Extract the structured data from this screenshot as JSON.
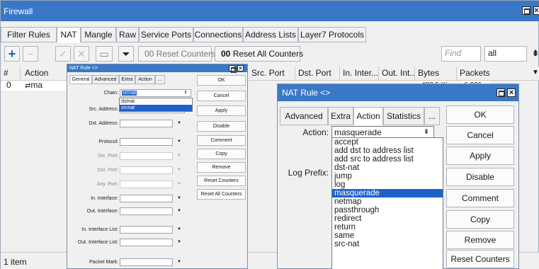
{
  "firewall": {
    "title": "Firewall",
    "tabs": [
      "Filter Rules",
      "NAT",
      "Mangle",
      "Raw",
      "Service Ports",
      "Connections",
      "Address Lists",
      "Layer7 Protocols"
    ],
    "toolbar": {
      "add_icon": "plus-icon",
      "remove_icon": "minus-icon",
      "enable_icon": "check-icon",
      "disable_icon": "cross-icon",
      "comment_icon": "note-icon",
      "filter_icon": "filter-icon",
      "reset_counters": "Reset Counters",
      "reset_all_counters": "Reset All Counters",
      "counter_prefix": "00",
      "find_placeholder": "Find",
      "scope_value": "all"
    },
    "table": {
      "columns": [
        "#",
        "Action",
        "Src. Port",
        "Dst. Port",
        "In. Inter...",
        "Out. Int...",
        "Bytes",
        "Packets"
      ],
      "rows": [
        {
          "num": "0",
          "action": "ma",
          "bytes": "483.5 KiB",
          "packets": "6 936"
        }
      ]
    },
    "status": "1 item"
  },
  "small_rule": {
    "title": "NAT Rule <>",
    "tabs": [
      "General",
      "Advanced",
      "Extra",
      "Action",
      "..."
    ],
    "fields": {
      "chain_label": "Chain:",
      "chain_value": "srcnat",
      "src_address_label": "Src. Address:",
      "src_address_value": "srcnat",
      "dst_address_label": "Dst. Address:",
      "protocol_label": "Protocol:",
      "src_port_label": "Src. Port:",
      "dst_port_label": "Dst. Port:",
      "any_port_label": "Any. Port:",
      "in_interface_label": "In. Interface:",
      "out_interface_label": "Out. Interface:",
      "in_interface_list_label": "In. Interface List:",
      "out_interface_list_label": "Out. Interface List:",
      "packet_mark_label": "Packet Mark:"
    },
    "chain_options": [
      "dstnat",
      "srcnat"
    ],
    "chain_selected": "srcnat",
    "buttons": [
      "OK",
      "Cancel",
      "Apply",
      "Disable",
      "Comment",
      "Copy",
      "Remove",
      "Reset Counters",
      "Reset All Counters"
    ]
  },
  "big_rule": {
    "title": "NAT Rule <>",
    "tabs": [
      "Advanced",
      "Extra",
      "Action",
      "Statistics",
      "..."
    ],
    "action_label": "Action:",
    "action_value": "masquerade",
    "log_prefix_label": "Log Prefix:",
    "action_options": [
      "accept",
      "add dst to address list",
      "add src to address list",
      "dst-nat",
      "jump",
      "log",
      "masquerade",
      "netmap",
      "passthrough",
      "redirect",
      "return",
      "same",
      "src-nat"
    ],
    "action_selected": "masquerade",
    "buttons": [
      "OK",
      "Cancel",
      "Apply",
      "Disable",
      "Comment",
      "Copy",
      "Remove",
      "Reset Counters"
    ]
  },
  "colors": {
    "title_bar": "#3a78c7",
    "selection": "#1e62c9",
    "add_icon": "#1a56c4"
  }
}
